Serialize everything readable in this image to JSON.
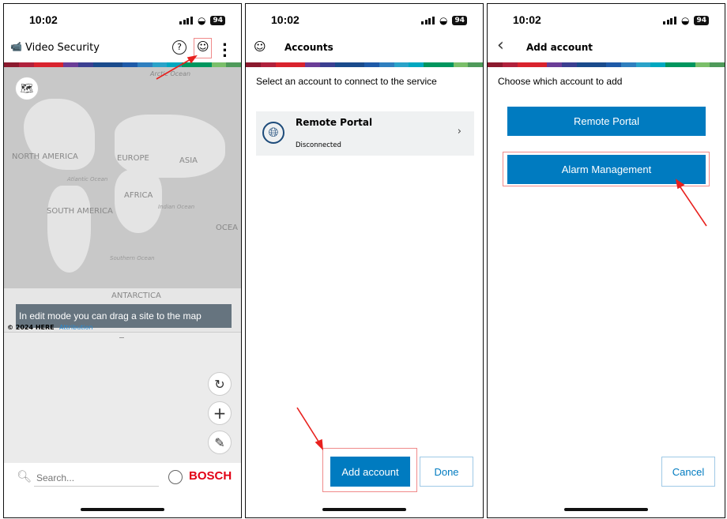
{
  "status": {
    "time": "10:02",
    "battery": "94"
  },
  "stripe_colors": [
    "#8b1a2e",
    "#b0213c",
    "#d9232e",
    "#d9232e",
    "#6b3d97",
    "#3b3f91",
    "#1a4b8c",
    "#1a4b8c",
    "#1e5aa8",
    "#2f7fbf",
    "#2aa3c9",
    "#00a8c0",
    "#00965e",
    "#00965e",
    "#7bbf6a",
    "#4f9a5a"
  ],
  "screen1": {
    "title": "Video Security",
    "map_labels": [
      "Arctic Ocean",
      "NORTH AMERICA",
      "EUROPE",
      "ASIA",
      "Atlantic Ocean",
      "AFRICA",
      "Indian Ocean",
      "SOUTH AMERICA",
      "OCEA",
      "Southern Ocean",
      "ANTARCTICA"
    ],
    "toast": "In edit mode you can drag a site to the map",
    "copyright": "© 2024 HERE",
    "attribution": "Attribution",
    "search_placeholder": "Search...",
    "brand": "BOSCH"
  },
  "screen2": {
    "title": "Accounts",
    "instruction": "Select an account to connect to the service",
    "account": {
      "name": "Remote Portal",
      "status": "Disconnected"
    },
    "add_account": "Add account",
    "done": "Done"
  },
  "screen3": {
    "title": "Add account",
    "instruction": "Choose which account to add",
    "option1": "Remote Portal",
    "option2": "Alarm Management",
    "cancel": "Cancel"
  },
  "colors": {
    "accent": "#007bc0",
    "brand": "#e20015",
    "highlight": "#f08a8a",
    "arrow": "#e8211e"
  }
}
